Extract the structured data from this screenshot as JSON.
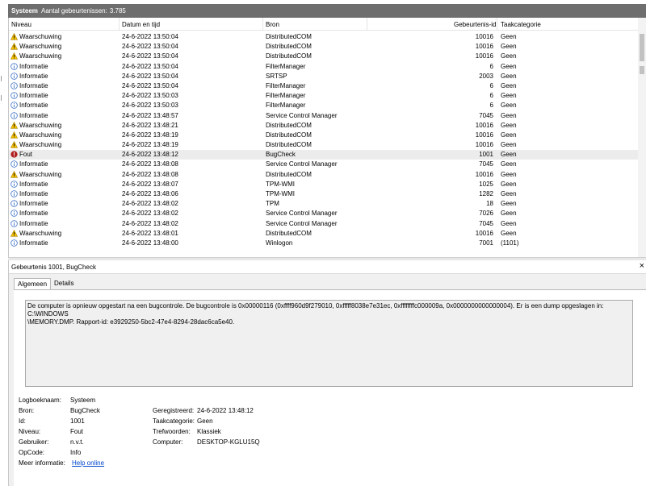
{
  "header": {
    "title": "Systeem",
    "count_label": "Aantal gebeurtenissen:",
    "count_value": "3.785"
  },
  "columns": {
    "level": "Niveau",
    "date": "Datum en tijd",
    "source": "Bron",
    "event_id": "Gebeurtenis-id",
    "category": "Taakcategorie"
  },
  "rows": [
    {
      "level": "Waarschuwing",
      "icon": "warning-icon",
      "date": "24-6-2022 13:50:04",
      "source": "DistributedCOM",
      "id": "10016",
      "cat": "Geen"
    },
    {
      "level": "Waarschuwing",
      "icon": "warning-icon",
      "date": "24-6-2022 13:50:04",
      "source": "DistributedCOM",
      "id": "10016",
      "cat": "Geen"
    },
    {
      "level": "Waarschuwing",
      "icon": "warning-icon",
      "date": "24-6-2022 13:50:04",
      "source": "DistributedCOM",
      "id": "10016",
      "cat": "Geen"
    },
    {
      "level": "Informatie",
      "icon": "info-icon",
      "date": "24-6-2022 13:50:04",
      "source": "FilterManager",
      "id": "6",
      "cat": "Geen"
    },
    {
      "level": "Informatie",
      "icon": "info-icon",
      "date": "24-6-2022 13:50:04",
      "source": "SRTSP",
      "id": "2003",
      "cat": "Geen"
    },
    {
      "level": "Informatie",
      "icon": "info-icon",
      "date": "24-6-2022 13:50:04",
      "source": "FilterManager",
      "id": "6",
      "cat": "Geen"
    },
    {
      "level": "Informatie",
      "icon": "info-icon",
      "date": "24-6-2022 13:50:03",
      "source": "FilterManager",
      "id": "6",
      "cat": "Geen"
    },
    {
      "level": "Informatie",
      "icon": "info-icon",
      "date": "24-6-2022 13:50:03",
      "source": "FilterManager",
      "id": "6",
      "cat": "Geen"
    },
    {
      "level": "Informatie",
      "icon": "info-icon",
      "date": "24-6-2022 13:48:57",
      "source": "Service Control Manager",
      "id": "7045",
      "cat": "Geen"
    },
    {
      "level": "Waarschuwing",
      "icon": "warning-icon",
      "date": "24-6-2022 13:48:21",
      "source": "DistributedCOM",
      "id": "10016",
      "cat": "Geen"
    },
    {
      "level": "Waarschuwing",
      "icon": "warning-icon",
      "date": "24-6-2022 13:48:19",
      "source": "DistributedCOM",
      "id": "10016",
      "cat": "Geen"
    },
    {
      "level": "Waarschuwing",
      "icon": "warning-icon",
      "date": "24-6-2022 13:48:19",
      "source": "DistributedCOM",
      "id": "10016",
      "cat": "Geen"
    },
    {
      "level": "Fout",
      "icon": "error-icon",
      "date": "24-6-2022 13:48:12",
      "source": "BugCheck",
      "id": "1001",
      "cat": "Geen",
      "selected": true
    },
    {
      "level": "Informatie",
      "icon": "info-icon",
      "date": "24-6-2022 13:48:08",
      "source": "Service Control Manager",
      "id": "7045",
      "cat": "Geen"
    },
    {
      "level": "Waarschuwing",
      "icon": "warning-icon",
      "date": "24-6-2022 13:48:08",
      "source": "DistributedCOM",
      "id": "10016",
      "cat": "Geen"
    },
    {
      "level": "Informatie",
      "icon": "info-icon",
      "date": "24-6-2022 13:48:07",
      "source": "TPM-WMI",
      "id": "1025",
      "cat": "Geen"
    },
    {
      "level": "Informatie",
      "icon": "info-icon",
      "date": "24-6-2022 13:48:06",
      "source": "TPM-WMI",
      "id": "1282",
      "cat": "Geen"
    },
    {
      "level": "Informatie",
      "icon": "info-icon",
      "date": "24-6-2022 13:48:02",
      "source": "TPM",
      "id": "18",
      "cat": "Geen"
    },
    {
      "level": "Informatie",
      "icon": "info-icon",
      "date": "24-6-2022 13:48:02",
      "source": "Service Control Manager",
      "id": "7026",
      "cat": "Geen"
    },
    {
      "level": "Informatie",
      "icon": "info-icon",
      "date": "24-6-2022 13:48:02",
      "source": "Service Control Manager",
      "id": "7045",
      "cat": "Geen"
    },
    {
      "level": "Waarschuwing",
      "icon": "warning-icon",
      "date": "24-6-2022 13:48:01",
      "source": "DistributedCOM",
      "id": "10016",
      "cat": "Geen"
    },
    {
      "level": "Informatie",
      "icon": "info-icon",
      "date": "24-6-2022 13:48:00",
      "source": "Winlogon",
      "id": "7001",
      "cat": "(1101)"
    }
  ],
  "detail": {
    "title": "Gebeurtenis 1001, BugCheck",
    "tabs": [
      "Algemeen",
      "Details"
    ],
    "message": "De computer is opnieuw opgestart na een bugcontrole. De bugcontrole is 0x00000116 (0xffff960d9f279010, 0xfffff8038e7e31ec, 0xffffffffc000009a, 0x0000000000000004). Er is een dump opgeslagen in: C:\\WINDOWS\n\\MEMORY.DMP. Rapport-id: e3929250-5bc2-47e4-8294-28dac6ca5e40.",
    "props": {
      "log_label": "Logboeknaam:",
      "log_value": "Systeem",
      "source_label": "Bron:",
      "source_value": "BugCheck",
      "id_label": "Id:",
      "id_value": "1001",
      "level_label": "Niveau:",
      "level_value": "Fout",
      "user_label": "Gebruiker:",
      "user_value": "n.v.t.",
      "opcode_label": "OpCode:",
      "opcode_value": "Info",
      "more_label": "Meer informatie:",
      "more_link": "Help online",
      "logged_label": "Geregistreerd:",
      "logged_value": "24-6-2022 13:48:12",
      "task_label": "Taakcategorie:",
      "task_value": "Geen",
      "keywords_label": "Trefwoorden:",
      "keywords_value": "Klassiek",
      "computer_label": "Computer:",
      "computer_value": "DESKTOP-KGLU15Q"
    }
  },
  "colors": {
    "header_bg": "#6e6e6e",
    "warning": "#f5c000",
    "info": "#3a6fc4",
    "error": "#b01e1e",
    "selected_row": "#ececec",
    "link": "#0044cc"
  }
}
